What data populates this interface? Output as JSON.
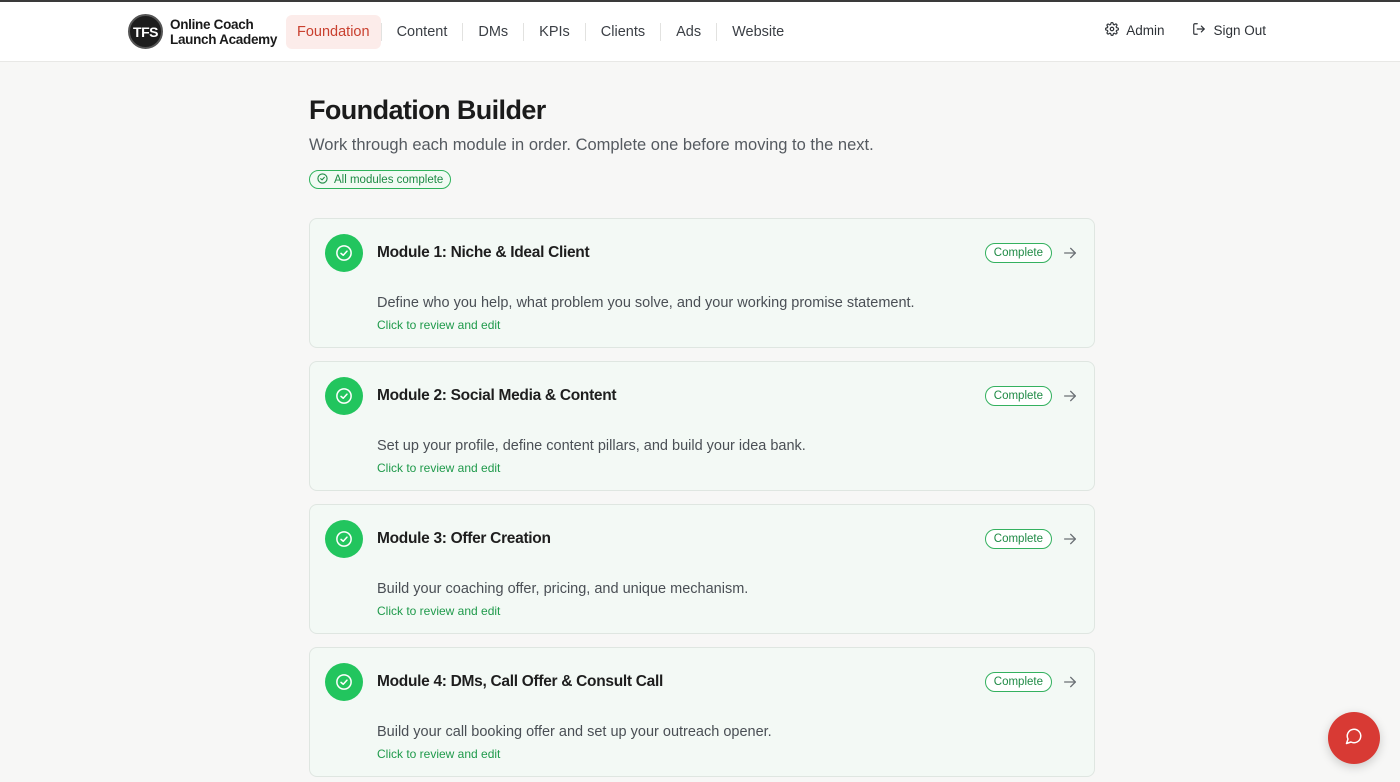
{
  "brand": {
    "logo_text": "TFS",
    "line1": "Online Coach",
    "line2": "Launch Academy"
  },
  "nav": {
    "items": [
      "Foundation",
      "Content",
      "DMs",
      "KPIs",
      "Clients",
      "Ads",
      "Website"
    ],
    "active": "Foundation"
  },
  "actions": {
    "admin": "Admin",
    "sign_out": "Sign Out"
  },
  "page": {
    "title": "Foundation Builder",
    "subtitle": "Work through each module in order. Complete one before moving to the next.",
    "summary_badge": "All modules complete"
  },
  "modules": [
    {
      "title": "Module 1: Niche & Ideal Client",
      "status": "Complete",
      "description": "Define who you help, what problem you solve, and your working promise statement.",
      "link": "Click to review and edit"
    },
    {
      "title": "Module 2: Social Media & Content",
      "status": "Complete",
      "description": "Set up your profile, define content pillars, and build your idea bank.",
      "link": "Click to review and edit"
    },
    {
      "title": "Module 3: Offer Creation",
      "status": "Complete",
      "description": "Build your coaching offer, pricing, and unique mechanism.",
      "link": "Click to review and edit"
    },
    {
      "title": "Module 4: DMs, Call Offer & Consult Call",
      "status": "Complete",
      "description": "Build your call booking offer and set up your outreach opener.",
      "link": "Click to review and edit"
    }
  ],
  "icons": {
    "module_status": "check-circle-icon",
    "admin": "gear-icon",
    "sign_out": "sign-out-icon",
    "chat": "chat-bubble-icon"
  },
  "colors": {
    "accent_red": "#d83a34",
    "active_nav_bg": "#fcecea",
    "active_nav_text": "#c9402f",
    "success_green": "#22c55e",
    "card_bg": "#f3f9f5"
  }
}
